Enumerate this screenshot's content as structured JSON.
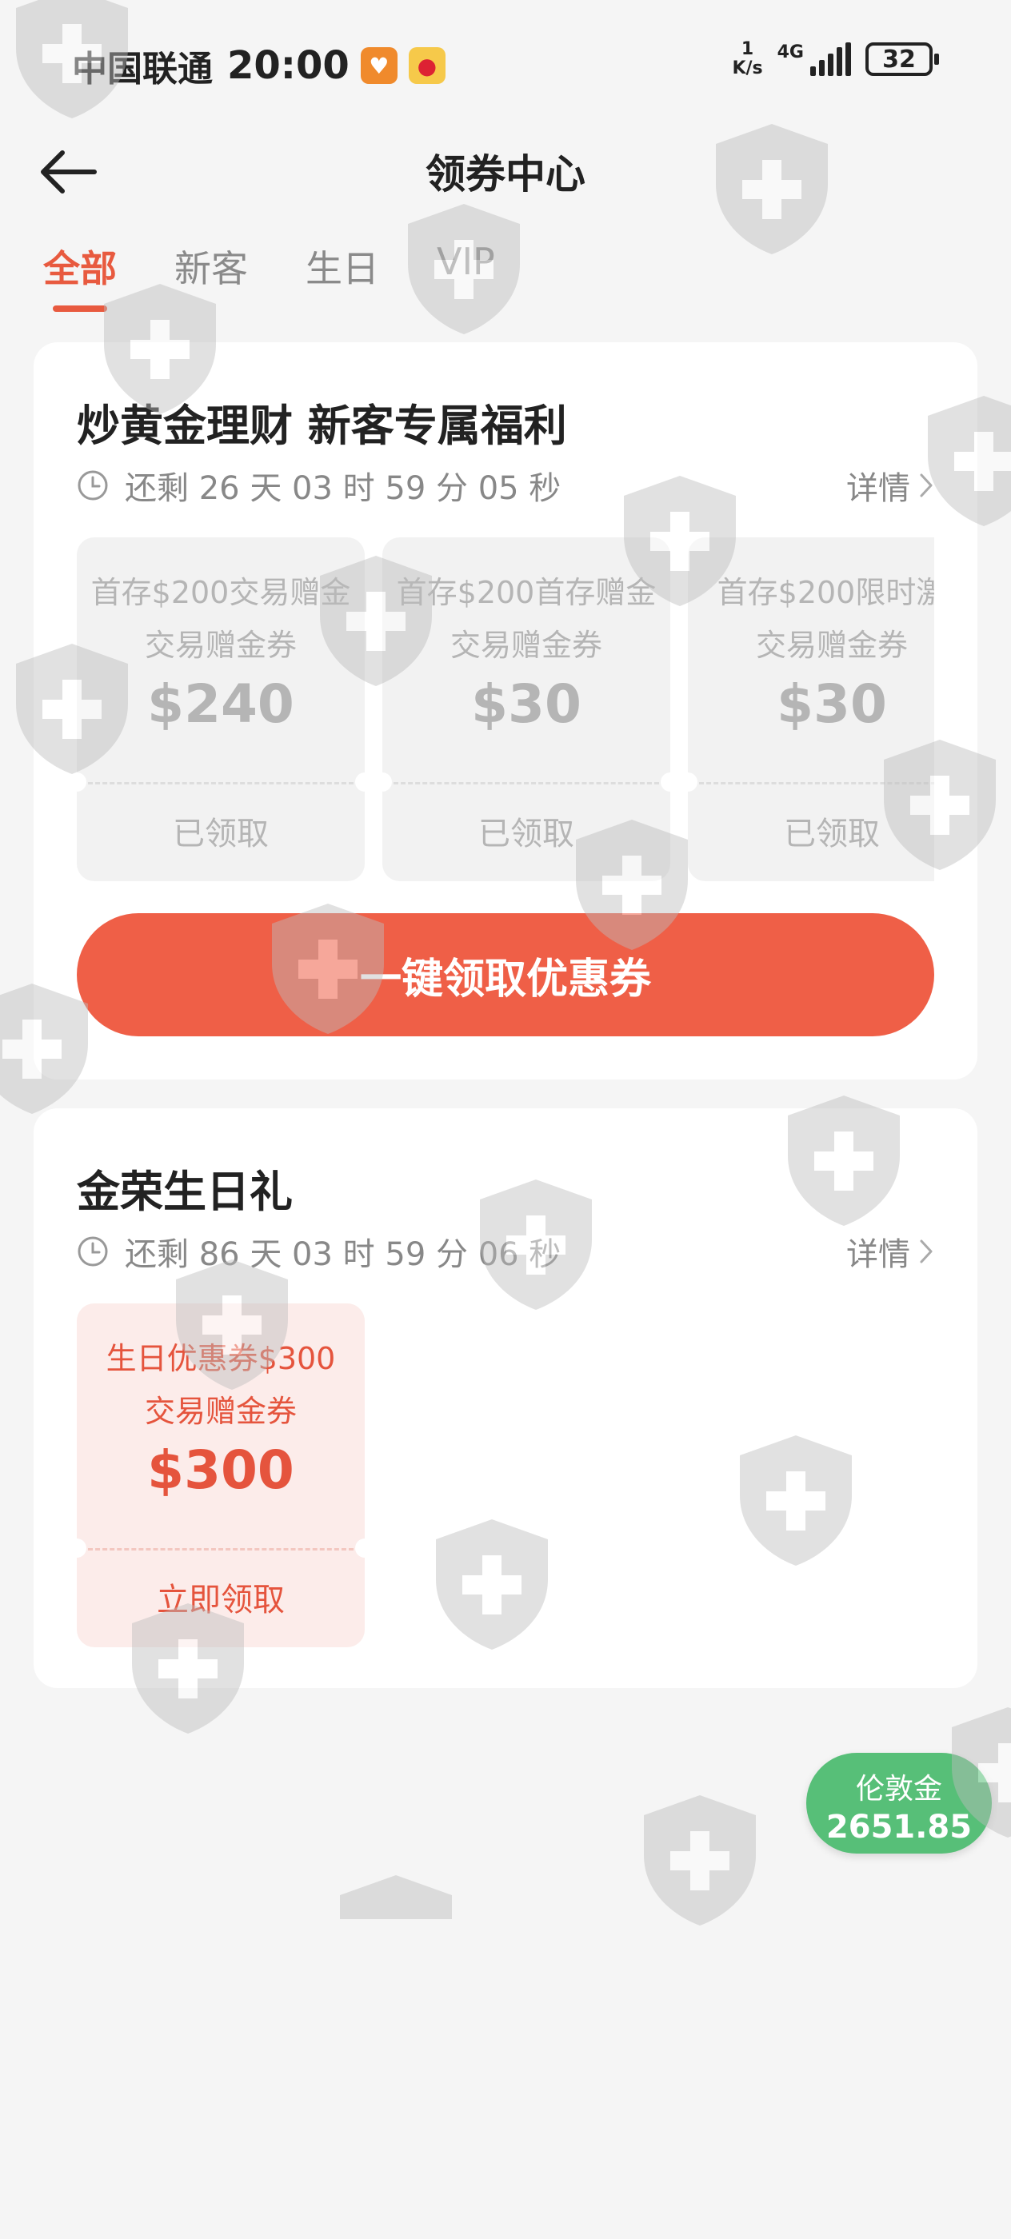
{
  "status_bar": {
    "carrier": "中国联通",
    "time": "20:00",
    "net_speed_value": "1",
    "net_speed_unit": "K/s",
    "network": "4G",
    "battery": "32"
  },
  "header": {
    "title": "领券中心"
  },
  "tabs": [
    {
      "label": "全部",
      "active": true
    },
    {
      "label": "新客",
      "active": false
    },
    {
      "label": "生日",
      "active": false
    },
    {
      "label": "VIP",
      "active": false
    }
  ],
  "section_new": {
    "title": "炒黄金理财 新客专属福利",
    "countdown": "还剩 26 天 03 时 59 分 05 秒",
    "details": "详情",
    "coupons": [
      {
        "name": "首存$200交易赠金",
        "type": "交易赠金券",
        "amount": "$240",
        "status": "已领取"
      },
      {
        "name": "首存$200首存赠金",
        "type": "交易赠金券",
        "amount": "$30",
        "status": "已领取"
      },
      {
        "name": "首存$200限时激",
        "type": "交易赠金券",
        "amount": "$30",
        "status": "已领取"
      }
    ],
    "claim_all": "一键领取优惠券"
  },
  "section_birthday": {
    "title": "金荣生日礼",
    "countdown": "还剩 86 天 03 时 59 分 06 秒",
    "details": "详情",
    "coupons": [
      {
        "name": "生日优惠券$300",
        "type": "交易赠金券",
        "amount": "$300",
        "status": "立即领取"
      }
    ]
  },
  "gold_badge": {
    "label": "伦敦金",
    "value": "2651.85"
  },
  "colors": {
    "accent": "#e85a3f",
    "button": "#ef5f47",
    "badge": "#57bf78",
    "background": "#f5f5f5"
  }
}
